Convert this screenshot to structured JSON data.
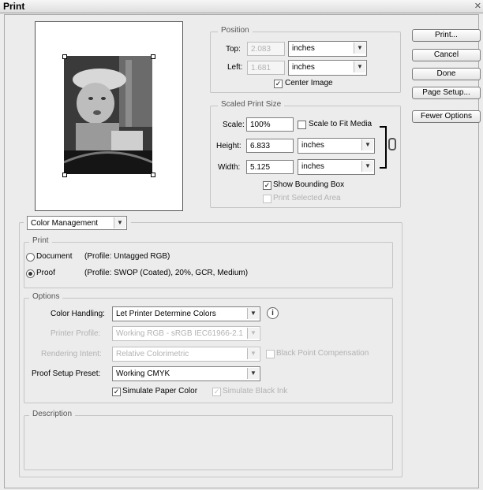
{
  "window": {
    "title": "Print",
    "close_glyph": "✕"
  },
  "buttons": {
    "print": "Print...",
    "cancel": "Cancel",
    "done": "Done",
    "page_setup": "Page Setup...",
    "fewer_options": "Fewer Options"
  },
  "position": {
    "legend": "Position",
    "top_label": "Top:",
    "top_value": "2.083",
    "top_unit": "inches",
    "left_label": "Left:",
    "left_value": "1.681",
    "left_unit": "inches",
    "center_image": "Center Image",
    "center_image_checked": true
  },
  "scaled": {
    "legend": "Scaled Print Size",
    "scale_label": "Scale:",
    "scale_value": "100%",
    "scale_to_fit": "Scale to Fit Media",
    "height_label": "Height:",
    "height_value": "6.833",
    "height_unit": "inches",
    "width_label": "Width:",
    "width_value": "5.125",
    "width_unit": "inches",
    "show_bbox": "Show Bounding Box",
    "print_selected": "Print Selected Area"
  },
  "color_management": {
    "dropdown": "Color Management",
    "print_group": {
      "legend": "Print",
      "document_label": "Document",
      "document_profile": "(Profile: Untagged RGB)",
      "proof_label": "Proof",
      "proof_profile": "(Profile: SWOP (Coated), 20%, GCR, Medium)",
      "selected": "proof"
    },
    "options": {
      "legend": "Options",
      "color_handling_label": "Color Handling:",
      "color_handling_value": "Let Printer Determine Colors",
      "printer_profile_label": "Printer Profile:",
      "printer_profile_value": "Working RGB - sRGB IEC61966-2.1",
      "rendering_intent_label": "Rendering Intent:",
      "rendering_intent_value": "Relative Colorimetric",
      "black_point": "Black Point Compensation",
      "proof_preset_label": "Proof Setup Preset:",
      "proof_preset_value": "Working CMYK",
      "simulate_paper": "Simulate Paper Color",
      "simulate_black": "Simulate Black Ink"
    },
    "description": {
      "legend": "Description"
    }
  },
  "icons": {
    "dropdown": "chevron-down-icon",
    "info": "info-icon",
    "link": "chain-link-icon",
    "check": "checkmark-icon"
  }
}
